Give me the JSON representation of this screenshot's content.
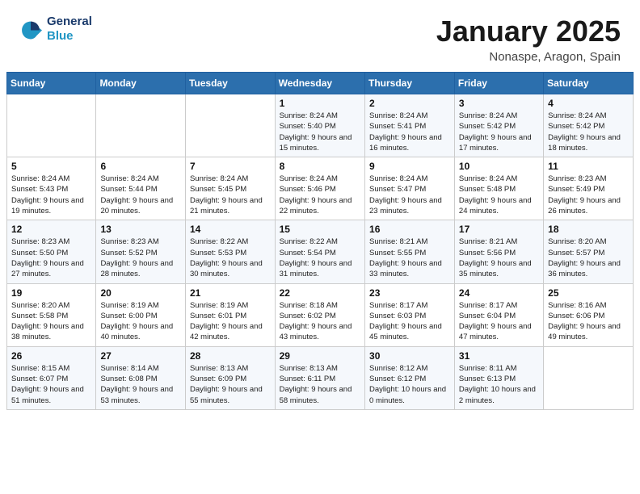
{
  "header": {
    "logo_line1": "General",
    "logo_line2": "Blue",
    "title": "January 2025",
    "subtitle": "Nonaspe, Aragon, Spain"
  },
  "weekdays": [
    "Sunday",
    "Monday",
    "Tuesday",
    "Wednesday",
    "Thursday",
    "Friday",
    "Saturday"
  ],
  "weeks": [
    [
      {
        "day": "",
        "info": ""
      },
      {
        "day": "",
        "info": ""
      },
      {
        "day": "",
        "info": ""
      },
      {
        "day": "1",
        "info": "Sunrise: 8:24 AM\nSunset: 5:40 PM\nDaylight: 9 hours and 15 minutes."
      },
      {
        "day": "2",
        "info": "Sunrise: 8:24 AM\nSunset: 5:41 PM\nDaylight: 9 hours and 16 minutes."
      },
      {
        "day": "3",
        "info": "Sunrise: 8:24 AM\nSunset: 5:42 PM\nDaylight: 9 hours and 17 minutes."
      },
      {
        "day": "4",
        "info": "Sunrise: 8:24 AM\nSunset: 5:42 PM\nDaylight: 9 hours and 18 minutes."
      }
    ],
    [
      {
        "day": "5",
        "info": "Sunrise: 8:24 AM\nSunset: 5:43 PM\nDaylight: 9 hours and 19 minutes."
      },
      {
        "day": "6",
        "info": "Sunrise: 8:24 AM\nSunset: 5:44 PM\nDaylight: 9 hours and 20 minutes."
      },
      {
        "day": "7",
        "info": "Sunrise: 8:24 AM\nSunset: 5:45 PM\nDaylight: 9 hours and 21 minutes."
      },
      {
        "day": "8",
        "info": "Sunrise: 8:24 AM\nSunset: 5:46 PM\nDaylight: 9 hours and 22 minutes."
      },
      {
        "day": "9",
        "info": "Sunrise: 8:24 AM\nSunset: 5:47 PM\nDaylight: 9 hours and 23 minutes."
      },
      {
        "day": "10",
        "info": "Sunrise: 8:24 AM\nSunset: 5:48 PM\nDaylight: 9 hours and 24 minutes."
      },
      {
        "day": "11",
        "info": "Sunrise: 8:23 AM\nSunset: 5:49 PM\nDaylight: 9 hours and 26 minutes."
      }
    ],
    [
      {
        "day": "12",
        "info": "Sunrise: 8:23 AM\nSunset: 5:50 PM\nDaylight: 9 hours and 27 minutes."
      },
      {
        "day": "13",
        "info": "Sunrise: 8:23 AM\nSunset: 5:52 PM\nDaylight: 9 hours and 28 minutes."
      },
      {
        "day": "14",
        "info": "Sunrise: 8:22 AM\nSunset: 5:53 PM\nDaylight: 9 hours and 30 minutes."
      },
      {
        "day": "15",
        "info": "Sunrise: 8:22 AM\nSunset: 5:54 PM\nDaylight: 9 hours and 31 minutes."
      },
      {
        "day": "16",
        "info": "Sunrise: 8:21 AM\nSunset: 5:55 PM\nDaylight: 9 hours and 33 minutes."
      },
      {
        "day": "17",
        "info": "Sunrise: 8:21 AM\nSunset: 5:56 PM\nDaylight: 9 hours and 35 minutes."
      },
      {
        "day": "18",
        "info": "Sunrise: 8:20 AM\nSunset: 5:57 PM\nDaylight: 9 hours and 36 minutes."
      }
    ],
    [
      {
        "day": "19",
        "info": "Sunrise: 8:20 AM\nSunset: 5:58 PM\nDaylight: 9 hours and 38 minutes."
      },
      {
        "day": "20",
        "info": "Sunrise: 8:19 AM\nSunset: 6:00 PM\nDaylight: 9 hours and 40 minutes."
      },
      {
        "day": "21",
        "info": "Sunrise: 8:19 AM\nSunset: 6:01 PM\nDaylight: 9 hours and 42 minutes."
      },
      {
        "day": "22",
        "info": "Sunrise: 8:18 AM\nSunset: 6:02 PM\nDaylight: 9 hours and 43 minutes."
      },
      {
        "day": "23",
        "info": "Sunrise: 8:17 AM\nSunset: 6:03 PM\nDaylight: 9 hours and 45 minutes."
      },
      {
        "day": "24",
        "info": "Sunrise: 8:17 AM\nSunset: 6:04 PM\nDaylight: 9 hours and 47 minutes."
      },
      {
        "day": "25",
        "info": "Sunrise: 8:16 AM\nSunset: 6:06 PM\nDaylight: 9 hours and 49 minutes."
      }
    ],
    [
      {
        "day": "26",
        "info": "Sunrise: 8:15 AM\nSunset: 6:07 PM\nDaylight: 9 hours and 51 minutes."
      },
      {
        "day": "27",
        "info": "Sunrise: 8:14 AM\nSunset: 6:08 PM\nDaylight: 9 hours and 53 minutes."
      },
      {
        "day": "28",
        "info": "Sunrise: 8:13 AM\nSunset: 6:09 PM\nDaylight: 9 hours and 55 minutes."
      },
      {
        "day": "29",
        "info": "Sunrise: 8:13 AM\nSunset: 6:11 PM\nDaylight: 9 hours and 58 minutes."
      },
      {
        "day": "30",
        "info": "Sunrise: 8:12 AM\nSunset: 6:12 PM\nDaylight: 10 hours and 0 minutes."
      },
      {
        "day": "31",
        "info": "Sunrise: 8:11 AM\nSunset: 6:13 PM\nDaylight: 10 hours and 2 minutes."
      },
      {
        "day": "",
        "info": ""
      }
    ]
  ]
}
